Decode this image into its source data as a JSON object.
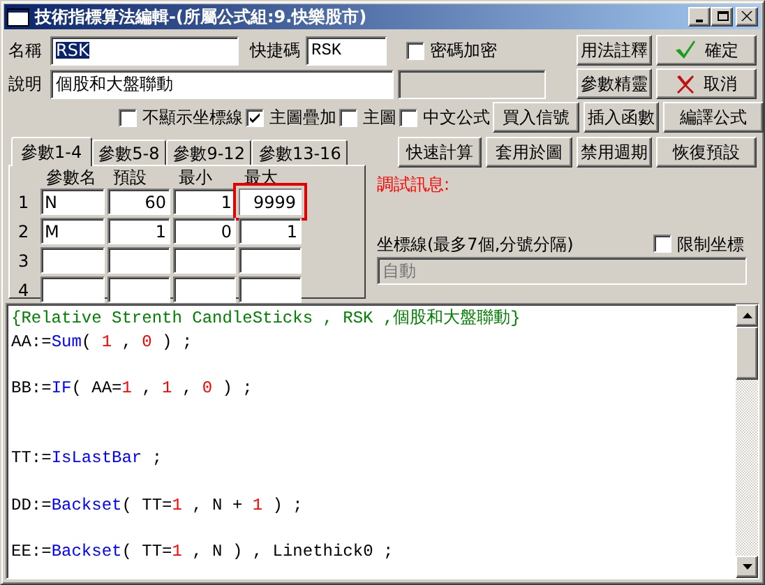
{
  "window": {
    "title": "技術指標算法編輯-(所屬公式組:9.快樂股市)"
  },
  "name_row": {
    "label": "名稱",
    "value": "RSK",
    "value_selected": true,
    "shortcut_label": "快捷碼",
    "shortcut_value": "RSK",
    "password": {
      "label": "密碼加密",
      "checked": false
    }
  },
  "desc_row": {
    "label": "說明",
    "value": "個股和大盤聯動"
  },
  "options": [
    {
      "label": "不顯示坐標線",
      "checked": false
    },
    {
      "label": "主圖疊加",
      "checked": true
    },
    {
      "label": "主圖",
      "checked": false
    },
    {
      "label": "中文公式",
      "checked": false
    }
  ],
  "button_rows": [
    [
      {
        "label": "用法註釋",
        "kind": "plain"
      },
      {
        "label": "確定",
        "kind": "confirm"
      }
    ],
    [
      {
        "label": "參數精靈",
        "kind": "plain"
      },
      {
        "label": "取消",
        "kind": "cancel"
      }
    ],
    [
      {
        "label": "買入信號",
        "kind": "plain"
      },
      {
        "label": "插入函數",
        "kind": "plain"
      },
      {
        "label": "編譯公式",
        "kind": "plain"
      }
    ],
    [
      {
        "label": "快速計算",
        "kind": "plain"
      },
      {
        "label": "套用於圖",
        "kind": "plain"
      },
      {
        "label": "禁用週期",
        "kind": "plain"
      },
      {
        "label": "恢復預設",
        "kind": "plain"
      }
    ]
  ],
  "tabs": [
    {
      "label": "參數1-4",
      "selected": true
    },
    {
      "label": "參數5-8",
      "selected": false
    },
    {
      "label": "參數9-12",
      "selected": false
    },
    {
      "label": "參數13-16",
      "selected": false
    }
  ],
  "params": {
    "columns": [
      "參數名",
      "預設",
      "最小",
      "最大"
    ],
    "rows": [
      {
        "number": "1",
        "cells": [
          {
            "text": "N",
            "highlighted": false
          },
          {
            "text": "60",
            "highlighted": false
          },
          {
            "text": "1",
            "highlighted": false
          },
          {
            "text": "9999",
            "highlighted": true
          }
        ]
      },
      {
        "number": "2",
        "cells": [
          {
            "text": "M",
            "highlighted": false
          },
          {
            "text": "1",
            "highlighted": false
          },
          {
            "text": "0",
            "highlighted": false
          },
          {
            "text": "1",
            "highlighted": false
          }
        ]
      },
      {
        "number": "3",
        "cells": [
          {
            "highlighted": false
          },
          {
            "highlighted": false
          },
          {
            "highlighted": false
          },
          {
            "highlighted": false
          }
        ]
      },
      {
        "number": "4",
        "cells": [
          {
            "highlighted": false
          },
          {
            "highlighted": false
          },
          {
            "highlighted": false
          },
          {
            "highlighted": false
          }
        ]
      }
    ]
  },
  "debug_label": "調試訊息:",
  "axis": {
    "label": "坐標線(最多7個,分號分隔)",
    "limit": {
      "label": "限制坐標",
      "checked": false
    },
    "placeholder": "自動"
  },
  "editor": {
    "lines": [
      {
        "kind": "code",
        "tokens": [
          {
            "kind": "comment",
            "text": "{Relative Strenth CandleSticks , RSK ,個股和大盤聯動}"
          }
        ]
      },
      {
        "kind": "code",
        "tokens": [
          {
            "kind": "plain",
            "text": "AA:="
          },
          {
            "kind": "func",
            "text": "Sum"
          },
          {
            "kind": "plain",
            "text": "( "
          },
          {
            "kind": "num",
            "text": "1"
          },
          {
            "kind": "plain",
            "text": " , "
          },
          {
            "kind": "num",
            "text": "0"
          },
          {
            "kind": "plain",
            "text": " ) ;"
          }
        ]
      },
      {
        "kind": "blank"
      },
      {
        "kind": "code",
        "tokens": [
          {
            "kind": "plain",
            "text": "BB:="
          },
          {
            "kind": "func",
            "text": "IF"
          },
          {
            "kind": "plain",
            "text": "( AA="
          },
          {
            "kind": "num",
            "text": "1"
          },
          {
            "kind": "plain",
            "text": " , "
          },
          {
            "kind": "num",
            "text": "1"
          },
          {
            "kind": "plain",
            "text": " , "
          },
          {
            "kind": "num",
            "text": "0"
          },
          {
            "kind": "plain",
            "text": " ) ;"
          }
        ]
      },
      {
        "kind": "blank"
      },
      {
        "kind": "blank"
      },
      {
        "kind": "code",
        "tokens": [
          {
            "kind": "plain",
            "text": "TT:="
          },
          {
            "kind": "func",
            "text": "IsLastBar"
          },
          {
            "kind": "plain",
            "text": " ;"
          }
        ]
      },
      {
        "kind": "blank"
      },
      {
        "kind": "code",
        "tokens": [
          {
            "kind": "plain",
            "text": "DD:="
          },
          {
            "kind": "func",
            "text": "Backset"
          },
          {
            "kind": "plain",
            "text": "( TT="
          },
          {
            "kind": "num",
            "text": "1"
          },
          {
            "kind": "plain",
            "text": " , N + "
          },
          {
            "kind": "num",
            "text": "1"
          },
          {
            "kind": "plain",
            "text": " ) ;"
          }
        ]
      },
      {
        "kind": "blank"
      },
      {
        "kind": "code",
        "tokens": [
          {
            "kind": "plain",
            "text": "EE:="
          },
          {
            "kind": "func",
            "text": "Backset"
          },
          {
            "kind": "plain",
            "text": "( TT="
          },
          {
            "kind": "num",
            "text": "1"
          },
          {
            "kind": "plain",
            "text": " , N ) , Linethick0 ;"
          }
        ]
      }
    ]
  }
}
